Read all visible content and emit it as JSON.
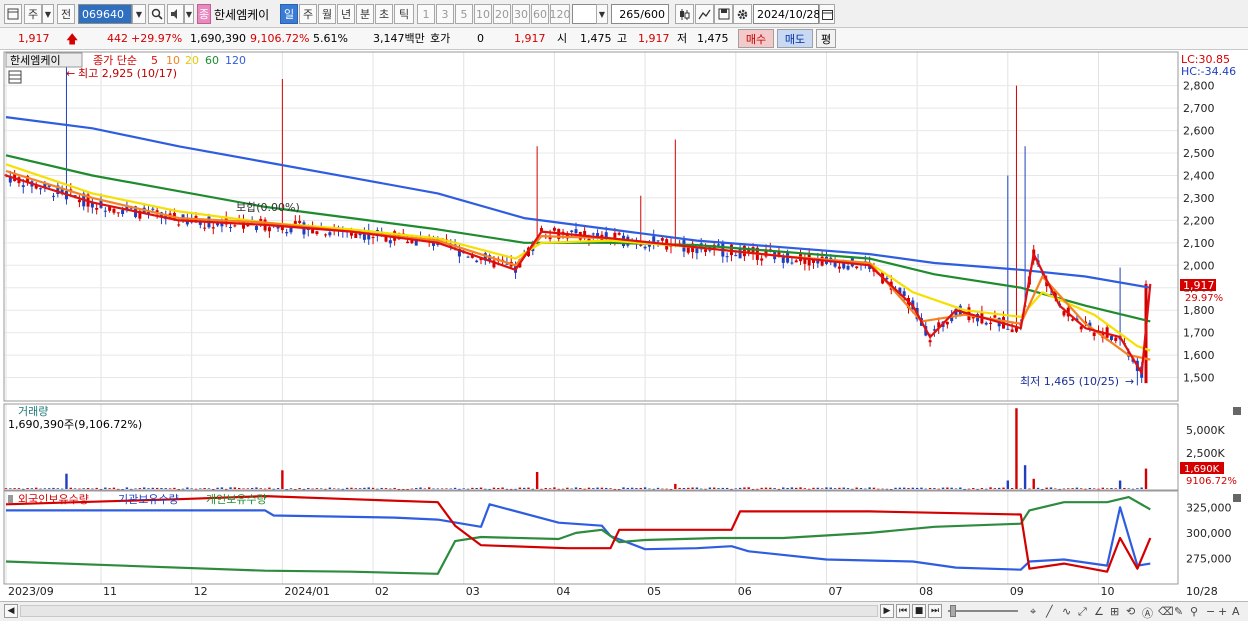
{
  "toolbar": {
    "type_select": "주",
    "prev_label": "전",
    "code": "069640",
    "name_badge": "종",
    "stock_name": "한세엠케이",
    "periods": [
      "일",
      "주",
      "월",
      "년",
      "분",
      "초",
      "틱"
    ],
    "active_period": "일",
    "intervals": [
      "1",
      "3",
      "5",
      "10",
      "20",
      "30",
      "60",
      "120"
    ],
    "count_value": "265",
    "count_total": "/600",
    "date": "2024/10/28"
  },
  "quote": {
    "price": "1,917",
    "change": "442",
    "change_pct": "+29.97%",
    "volume": "1,690,390",
    "volume_ratio": "9,106.72%",
    "turnover": "5.61%",
    "amount": "3,147백만",
    "hoga_label": "호가",
    "hoga_value": "0",
    "hoga_price": "1,917",
    "open_label": "시",
    "open": "1,475",
    "high_label": "고",
    "high": "1,917",
    "low_label": "저",
    "low": "1,475",
    "buy_button": "매수",
    "sell_button": "매도",
    "avg_button": "평"
  },
  "legend": {
    "name": "한세엠케이",
    "close_label": "종가 단순",
    "ma_periods": [
      "5",
      "10",
      "20",
      "60",
      "120"
    ],
    "max_label": "최고 2,925 (10/17)",
    "min_label": "최저 1,465 (10/25)",
    "flat_label": "보합(0.00%)",
    "lc": "LC:30.85",
    "hc": "HC:-34.46",
    "last_price": "1,917",
    "last_pct": "29.97%"
  },
  "volume_panel": {
    "title": "거래량",
    "info": "1,690,390주(9,106.72%)",
    "last_value": "1,690K",
    "last_pct": "9106.72%"
  },
  "holding_panel": {
    "titles": [
      "외국인보유수량",
      "기관보유수량",
      "개인보유수량"
    ]
  },
  "colors": {
    "up": "#d40000",
    "down": "#1f3fbf",
    "ma5": "#e01010",
    "ma10": "#f58220",
    "ma20": "#f5e000",
    "ma60": "#1e8c2e",
    "ma120": "#2f5de0"
  },
  "chart_data": {
    "type": "line",
    "title": "",
    "x_ticks": [
      "2023/09",
      "11",
      "12",
      "2024/01",
      "02",
      "03",
      "04",
      "05",
      "06",
      "07",
      "08",
      "09",
      "10",
      "10/28"
    ],
    "price_axis": {
      "ticks": [
        2800,
        2700,
        2600,
        2500,
        2400,
        2300,
        2200,
        2100,
        2000,
        1900,
        1800,
        1700,
        1600,
        1500
      ],
      "ylim": [
        1400,
        2950
      ]
    },
    "volume_axis": {
      "ticks": [
        "5,000K",
        "2,500K"
      ]
    },
    "holding_axis": {
      "ticks": [
        "325,000",
        "300,000",
        "275,000"
      ],
      "ylim": [
        250000,
        340000
      ]
    },
    "ma_key_points": {
      "ma5": [
        [
          0,
          2400
        ],
        [
          20,
          2280
        ],
        [
          40,
          2200
        ],
        [
          60,
          2180
        ],
        [
          80,
          2150
        ],
        [
          100,
          2100
        ],
        [
          118,
          1980
        ],
        [
          124,
          2150
        ],
        [
          140,
          2120
        ],
        [
          160,
          2080
        ],
        [
          180,
          2040
        ],
        [
          200,
          2000
        ],
        [
          210,
          1820
        ],
        [
          214,
          1680
        ],
        [
          220,
          1800
        ],
        [
          235,
          1720
        ],
        [
          238,
          2050
        ],
        [
          244,
          1820
        ],
        [
          250,
          1720
        ],
        [
          258,
          1680
        ],
        [
          263,
          1520
        ],
        [
          265,
          1917
        ]
      ],
      "ma10": [
        [
          0,
          2420
        ],
        [
          20,
          2300
        ],
        [
          40,
          2210
        ],
        [
          60,
          2190
        ],
        [
          80,
          2150
        ],
        [
          100,
          2110
        ],
        [
          118,
          2000
        ],
        [
          124,
          2130
        ],
        [
          140,
          2120
        ],
        [
          160,
          2080
        ],
        [
          180,
          2040
        ],
        [
          200,
          2010
        ],
        [
          212,
          1750
        ],
        [
          222,
          1780
        ],
        [
          235,
          1740
        ],
        [
          240,
          1950
        ],
        [
          250,
          1740
        ],
        [
          260,
          1600
        ],
        [
          265,
          1580
        ]
      ],
      "ma20": [
        [
          0,
          2450
        ],
        [
          20,
          2320
        ],
        [
          40,
          2240
        ],
        [
          60,
          2190
        ],
        [
          80,
          2160
        ],
        [
          100,
          2120
        ],
        [
          118,
          2030
        ],
        [
          124,
          2100
        ],
        [
          140,
          2110
        ],
        [
          160,
          2080
        ],
        [
          180,
          2040
        ],
        [
          200,
          2010
        ],
        [
          210,
          1880
        ],
        [
          222,
          1800
        ],
        [
          235,
          1770
        ],
        [
          240,
          1880
        ],
        [
          252,
          1780
        ],
        [
          262,
          1640
        ],
        [
          265,
          1620
        ]
      ],
      "ma60": [
        [
          0,
          2490
        ],
        [
          20,
          2400
        ],
        [
          40,
          2330
        ],
        [
          60,
          2260
        ],
        [
          80,
          2210
        ],
        [
          100,
          2160
        ],
        [
          120,
          2100
        ],
        [
          140,
          2100
        ],
        [
          160,
          2090
        ],
        [
          180,
          2060
        ],
        [
          200,
          2030
        ],
        [
          215,
          1960
        ],
        [
          235,
          1900
        ],
        [
          250,
          1820
        ],
        [
          265,
          1750
        ]
      ],
      "ma120": [
        [
          0,
          2660
        ],
        [
          20,
          2610
        ],
        [
          40,
          2530
        ],
        [
          60,
          2460
        ],
        [
          80,
          2390
        ],
        [
          100,
          2320
        ],
        [
          120,
          2210
        ],
        [
          140,
          2160
        ],
        [
          160,
          2110
        ],
        [
          180,
          2080
        ],
        [
          200,
          2050
        ],
        [
          215,
          2010
        ],
        [
          235,
          1980
        ],
        [
          250,
          1950
        ],
        [
          265,
          1900
        ]
      ]
    },
    "holding_series": {
      "foreign": [
        [
          0,
          328000
        ],
        [
          40,
          333000
        ],
        [
          60,
          336000
        ],
        [
          80,
          333000
        ],
        [
          100,
          330000
        ],
        [
          104,
          307000
        ],
        [
          110,
          288000
        ],
        [
          130,
          285000
        ],
        [
          140,
          285000
        ],
        [
          142,
          303000
        ],
        [
          168,
          303000
        ],
        [
          170,
          321000
        ],
        [
          200,
          321000
        ],
        [
          235,
          318000
        ],
        [
          237,
          265000
        ],
        [
          245,
          270000
        ],
        [
          255,
          262000
        ],
        [
          258,
          295000
        ],
        [
          262,
          265000
        ],
        [
          265,
          295000
        ]
      ],
      "institution": [
        [
          0,
          322000
        ],
        [
          60,
          322000
        ],
        [
          62,
          317000
        ],
        [
          90,
          315000
        ],
        [
          100,
          313000
        ],
        [
          110,
          306000
        ],
        [
          112,
          328000
        ],
        [
          128,
          310000
        ],
        [
          138,
          307000
        ],
        [
          140,
          297000
        ],
        [
          148,
          284000
        ],
        [
          160,
          285000
        ],
        [
          168,
          287000
        ],
        [
          172,
          282000
        ],
        [
          190,
          274000
        ],
        [
          210,
          272000
        ],
        [
          220,
          266000
        ],
        [
          235,
          264000
        ],
        [
          237,
          272000
        ],
        [
          245,
          274000
        ],
        [
          255,
          268000
        ],
        [
          258,
          325000
        ],
        [
          262,
          268000
        ],
        [
          265,
          270000
        ]
      ],
      "individual": [
        [
          0,
          272000
        ],
        [
          60,
          263000
        ],
        [
          80,
          262000
        ],
        [
          100,
          260000
        ],
        [
          104,
          292000
        ],
        [
          110,
          296000
        ],
        [
          128,
          294000
        ],
        [
          132,
          300000
        ],
        [
          138,
          303000
        ],
        [
          142,
          291000
        ],
        [
          148,
          293000
        ],
        [
          165,
          295000
        ],
        [
          180,
          295000
        ],
        [
          200,
          300000
        ],
        [
          215,
          306000
        ],
        [
          235,
          309000
        ],
        [
          237,
          322000
        ],
        [
          245,
          330000
        ],
        [
          255,
          330000
        ],
        [
          260,
          335000
        ],
        [
          265,
          323000
        ]
      ]
    }
  }
}
